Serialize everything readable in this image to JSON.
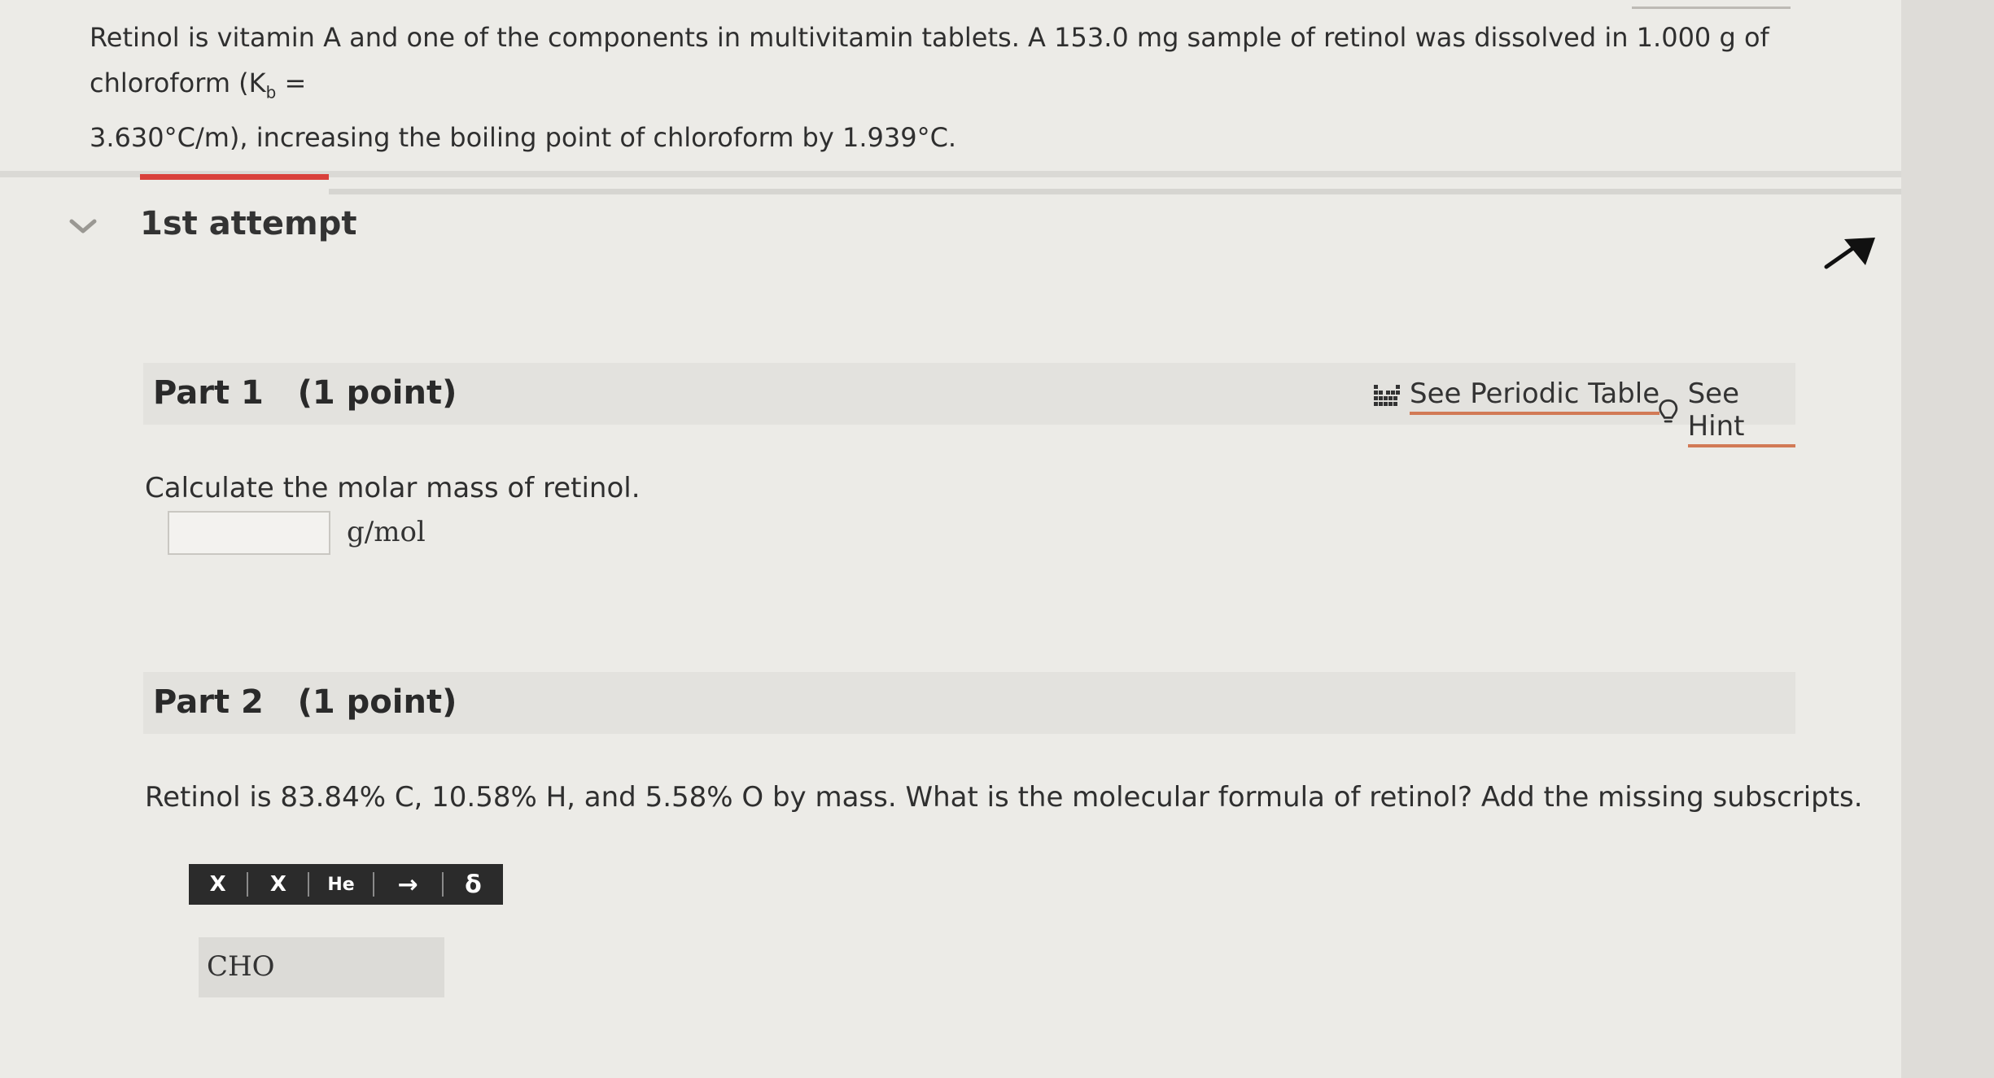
{
  "question": {
    "line1_text": "Retinol is vitamin A and one of the components in multivitamin tablets. A 153.0 mg sample of retinol was dissolved in 1.000 g of chloroform (K",
    "kb_sub": "b",
    "line1_end": " =",
    "line2": "3.630°C/m), increasing the boiling point of chloroform by 1.939°C."
  },
  "attempt": {
    "label": "1st attempt"
  },
  "colors": {
    "accent_red": "#d9403b",
    "link_underline": "#d27a56"
  },
  "part1": {
    "title": "Part 1   (1 point)",
    "periodic_label": "See Periodic Table",
    "periodic_icon": "periodic-table-icon",
    "hint_label": "See Hint",
    "hint_icon": "lightbulb-icon",
    "question": "Calculate the molar mass of retinol.",
    "input_value": "",
    "unit": "g/mol"
  },
  "part2": {
    "title": "Part 2   (1 point)",
    "question": "Retinol is 83.84% C, 10.58% H, and 5.58% O by mass. What is the molecular formula of retinol? Add the missing subscripts.",
    "toolbar": {
      "sup": "X",
      "sub": "X",
      "element": "He",
      "arrow": "→",
      "delta": "δ"
    },
    "formula_value": "CHO"
  }
}
